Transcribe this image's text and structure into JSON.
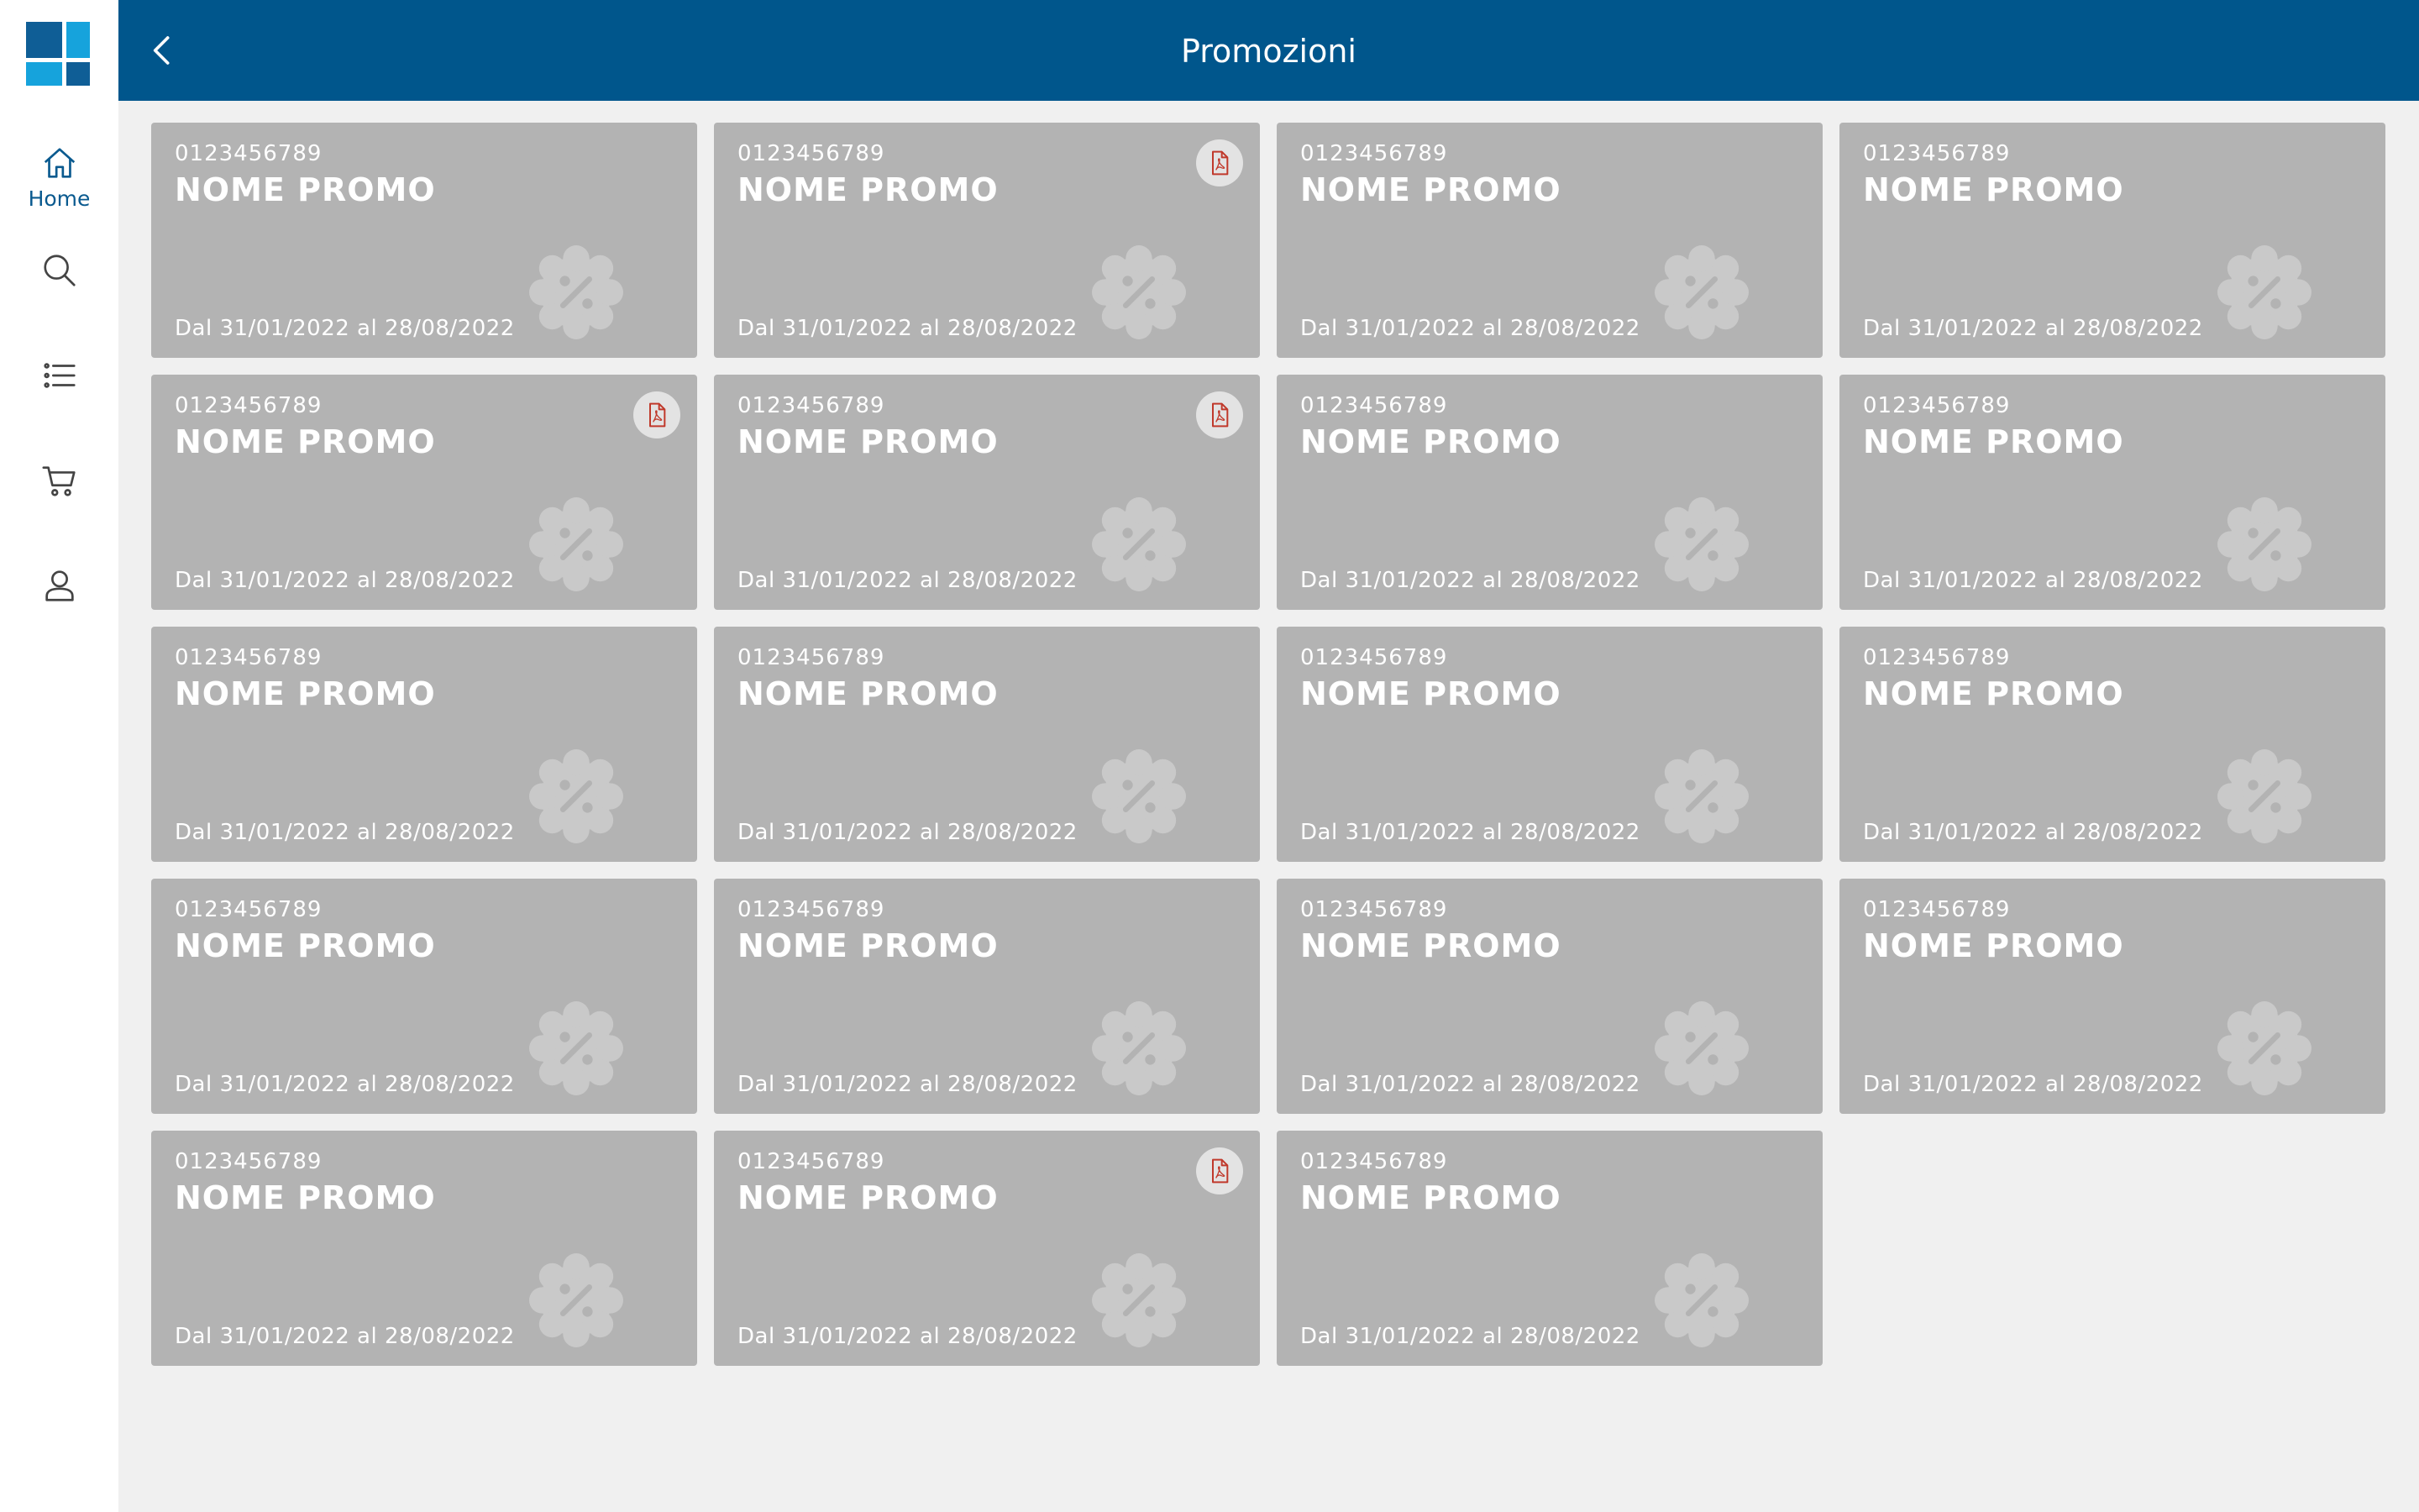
{
  "app": {
    "brand_colors": {
      "primary": "#00568c",
      "accent": "#16a3dc",
      "pdf_red": "#c0392b",
      "card_bg": "#b3b3b3"
    }
  },
  "sidebar": {
    "items": [
      {
        "label": "Home",
        "icon": "home-icon",
        "active": true
      },
      {
        "label": "",
        "icon": "search-icon",
        "active": false
      },
      {
        "label": "",
        "icon": "list-icon",
        "active": false
      },
      {
        "label": "",
        "icon": "cart-icon",
        "active": false
      },
      {
        "label": "",
        "icon": "user-icon",
        "active": false
      }
    ]
  },
  "header": {
    "title": "Promozioni",
    "back_icon": "chevron-left-icon"
  },
  "promotions": [
    {
      "code": "0123456789",
      "name": "NOME PROMO",
      "period": "Dal 31/01/2022 al 28/08/2022",
      "has_pdf": false
    },
    {
      "code": "0123456789",
      "name": "NOME PROMO",
      "period": "Dal 31/01/2022 al 28/08/2022",
      "has_pdf": true
    },
    {
      "code": "0123456789",
      "name": "NOME PROMO",
      "period": "Dal 31/01/2022 al 28/08/2022",
      "has_pdf": false
    },
    {
      "code": "0123456789",
      "name": "NOME PROMO",
      "period": "Dal 31/01/2022 al 28/08/2022",
      "has_pdf": false
    },
    {
      "code": "0123456789",
      "name": "NOME PROMO",
      "period": "Dal 31/01/2022 al 28/08/2022",
      "has_pdf": true
    },
    {
      "code": "0123456789",
      "name": "NOME PROMO",
      "period": "Dal 31/01/2022 al 28/08/2022",
      "has_pdf": true
    },
    {
      "code": "0123456789",
      "name": "NOME PROMO",
      "period": "Dal 31/01/2022 al 28/08/2022",
      "has_pdf": false
    },
    {
      "code": "0123456789",
      "name": "NOME PROMO",
      "period": "Dal 31/01/2022 al 28/08/2022",
      "has_pdf": false
    },
    {
      "code": "0123456789",
      "name": "NOME PROMO",
      "period": "Dal 31/01/2022 al 28/08/2022",
      "has_pdf": false
    },
    {
      "code": "0123456789",
      "name": "NOME PROMO",
      "period": "Dal 31/01/2022 al 28/08/2022",
      "has_pdf": false
    },
    {
      "code": "0123456789",
      "name": "NOME PROMO",
      "period": "Dal 31/01/2022 al 28/08/2022",
      "has_pdf": false
    },
    {
      "code": "0123456789",
      "name": "NOME PROMO",
      "period": "Dal 31/01/2022 al 28/08/2022",
      "has_pdf": false
    },
    {
      "code": "0123456789",
      "name": "NOME PROMO",
      "period": "Dal 31/01/2022 al 28/08/2022",
      "has_pdf": false
    },
    {
      "code": "0123456789",
      "name": "NOME PROMO",
      "period": "Dal 31/01/2022 al 28/08/2022",
      "has_pdf": false
    },
    {
      "code": "0123456789",
      "name": "NOME PROMO",
      "period": "Dal 31/01/2022 al 28/08/2022",
      "has_pdf": false
    },
    {
      "code": "0123456789",
      "name": "NOME PROMO",
      "period": "Dal 31/01/2022 al 28/08/2022",
      "has_pdf": false
    },
    {
      "code": "0123456789",
      "name": "NOME PROMO",
      "period": "Dal 31/01/2022 al 28/08/2022",
      "has_pdf": false
    },
    {
      "code": "0123456789",
      "name": "NOME PROMO",
      "period": "Dal 31/01/2022 al 28/08/2022",
      "has_pdf": true
    },
    {
      "code": "0123456789",
      "name": "NOME PROMO",
      "period": "Dal 31/01/2022 al 28/08/2022",
      "has_pdf": false
    }
  ]
}
